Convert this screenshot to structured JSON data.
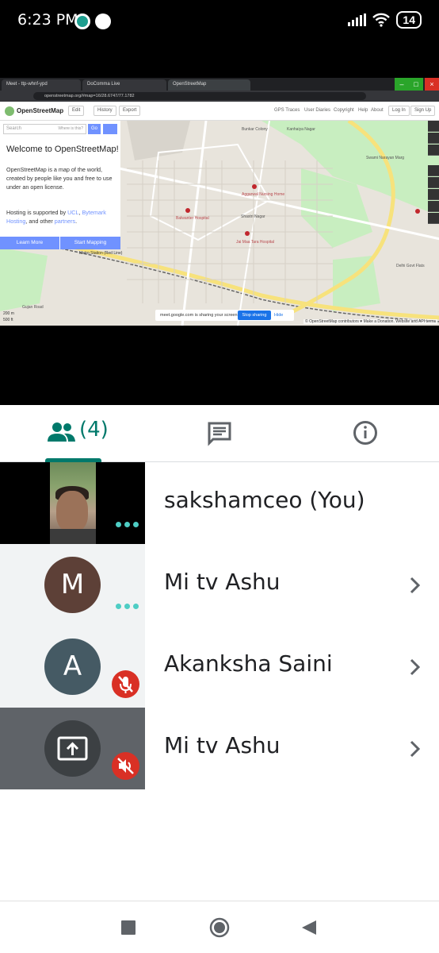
{
  "status_bar": {
    "time": "6:23 PM",
    "battery": "14",
    "icons": [
      "jio-icon",
      "chat-icon",
      "signal-icon",
      "wifi-icon",
      "battery-icon"
    ]
  },
  "shared_screen": {
    "browser_tabs": [
      "Meet - ttp-whnf-ypd",
      "DoComma Live",
      "OpenStreetMap"
    ],
    "url": "openstreetmap.org/#map=16/28.6747/77.1782",
    "site_title": "OpenStreetMap",
    "header_buttons": [
      "Edit",
      "History",
      "Export"
    ],
    "header_links": [
      "GPS Traces",
      "User Diaries",
      "Copyright",
      "Help",
      "About"
    ],
    "auth_buttons": [
      "Log In",
      "Sign Up"
    ],
    "search_placeholder": "Search",
    "search_hint": "Where is this?",
    "go_label": "Go",
    "welcome_title": "Welcome to OpenStreetMap!",
    "welcome_text": "OpenStreetMap is a map of the world, created by people like you and free to use under an open license.",
    "support_text_prefix": "Hosting is supported by ",
    "support_ucl": "UCL",
    "support_sep": ", ",
    "support_bytemark": "Bytemark Hosting",
    "support_mid": ", and other ",
    "support_partners": "partners",
    "support_end": ".",
    "learn_more": "Learn More",
    "start_mapping": "Start Mapping",
    "share_banner_text": "meet.google.com is sharing your screen.",
    "stop_sharing": "Stop sharing",
    "hide": "Hide",
    "attribution": "© OpenStreetMap contributors ♥ Make a Donation. Website and API terms",
    "map_labels": [
      "Aggarwal Nursing Home",
      "Shastri Nagar",
      "Balwanter Hospital",
      "Jai Maa Tara Hospital",
      "Metro Station (Red Line)",
      "Delhi Govt Flats",
      "Swami Narayan Marg",
      "Bunkar Colony",
      "Kanhaiya Nagar",
      "Gujan Road"
    ],
    "scale": [
      "200 m",
      "500 ft"
    ]
  },
  "meet": {
    "tabs": [
      {
        "name": "people",
        "icon": "people-icon",
        "count": "(4)",
        "active": true
      },
      {
        "name": "chat",
        "icon": "chat-bubble-icon"
      },
      {
        "name": "info",
        "icon": "info-icon"
      }
    ],
    "accent": "#00796b",
    "participants": [
      {
        "name": "sakshamceo (You)",
        "tile": "video",
        "status": "speaking-dots",
        "chevron": false
      },
      {
        "name": "Mi tv Ashu",
        "initial": "M",
        "avatar_color": "#5d4037",
        "status": "speaking-dots",
        "chevron": true
      },
      {
        "name": "Akanksha Saini",
        "initial": "A",
        "avatar_color": "#455a64",
        "status": "mic-muted",
        "chevron": true
      },
      {
        "name": "Mi tv Ashu",
        "tile": "presentation",
        "status": "audio-muted",
        "chevron": true
      }
    ]
  },
  "nav_bar": {
    "buttons": [
      "recents-square-icon",
      "home-circle-icon",
      "back-triangle-icon"
    ]
  }
}
